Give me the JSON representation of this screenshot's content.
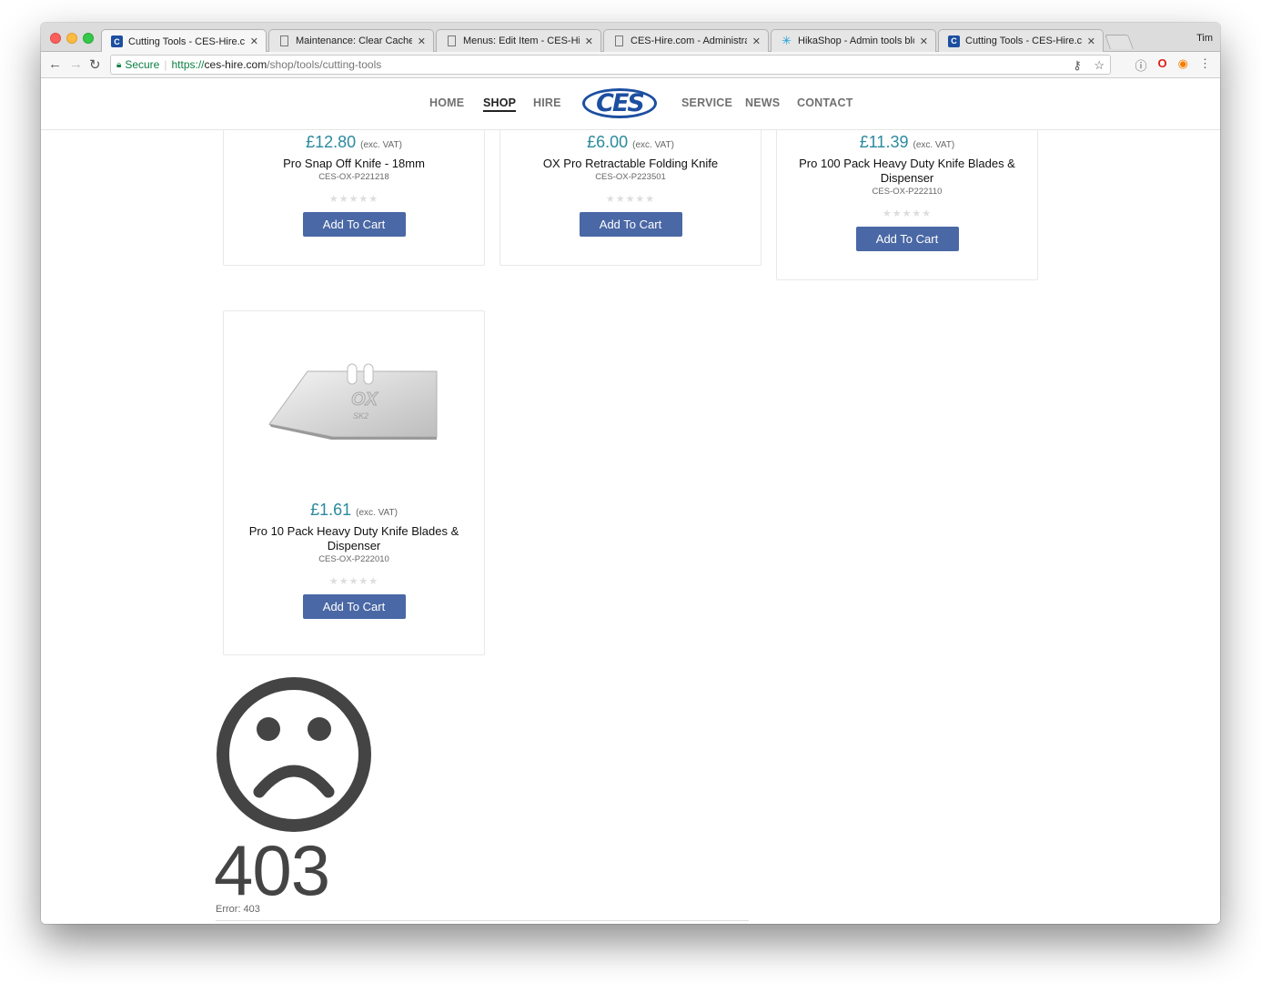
{
  "browser": {
    "tabs": [
      {
        "title": "Cutting Tools - CES-Hire.com",
        "icon": "ces-favicon-icon",
        "active": true
      },
      {
        "title": "Maintenance: Clear Cache (Sit",
        "icon": "document-icon",
        "active": false
      },
      {
        "title": "Menus: Edit Item - CES-Hire.c",
        "icon": "document-icon",
        "active": false
      },
      {
        "title": "CES-Hire.com - Administration",
        "icon": "document-icon",
        "active": false
      },
      {
        "title": "HikaShop - Admin tools blocks",
        "icon": "hikashop-icon",
        "active": false
      },
      {
        "title": "Cutting Tools - CES-Hire.com",
        "icon": "ces-favicon-icon",
        "active": false
      }
    ],
    "profile_name": "Tim",
    "secure_label": "Secure",
    "url_scheme": "https://",
    "url_host": "ces-hire.com",
    "url_path": "/shop/tools/cutting-tools"
  },
  "site": {
    "nav_left": [
      "HOME",
      "SHOP",
      "HIRE"
    ],
    "logo_text": "CES",
    "nav_right": [
      "SERVICE",
      "NEWS",
      "CONTACT"
    ],
    "active_nav": "SHOP"
  },
  "products": [
    {
      "price": "£12.80",
      "vat": "(exc. VAT)",
      "name": "Pro Snap Off Knife - 18mm",
      "sku": "CES-OX-P221218",
      "rating": 0,
      "button": "Add To Cart"
    },
    {
      "price": "£6.00",
      "vat": "(exc. VAT)",
      "name": "OX Pro Retractable Folding Knife",
      "sku": "CES-OX-P223501",
      "rating": 0,
      "button": "Add To Cart"
    },
    {
      "price": "£11.39",
      "vat": "(exc. VAT)",
      "name": "Pro 100 Pack Heavy Duty Knife Blades & Dispenser",
      "sku": "CES-OX-P222110",
      "rating": 0,
      "button": "Add To Cart"
    },
    {
      "price": "£1.61",
      "vat": "(exc. VAT)",
      "name": "Pro 10 Pack Heavy Duty Knife Blades & Dispenser",
      "sku": "CES-OX-P222010",
      "rating": 0,
      "button": "Add To Cart",
      "image_text": "OX",
      "image_subtext": "SK2"
    }
  ],
  "error": {
    "icon": "sad-face-icon",
    "code": "403",
    "label": "Error: 403"
  },
  "colors": {
    "price": "#2b8a9e",
    "button": "#4a68a5",
    "brand": "#1d4fa0",
    "secure": "#0b8043"
  }
}
